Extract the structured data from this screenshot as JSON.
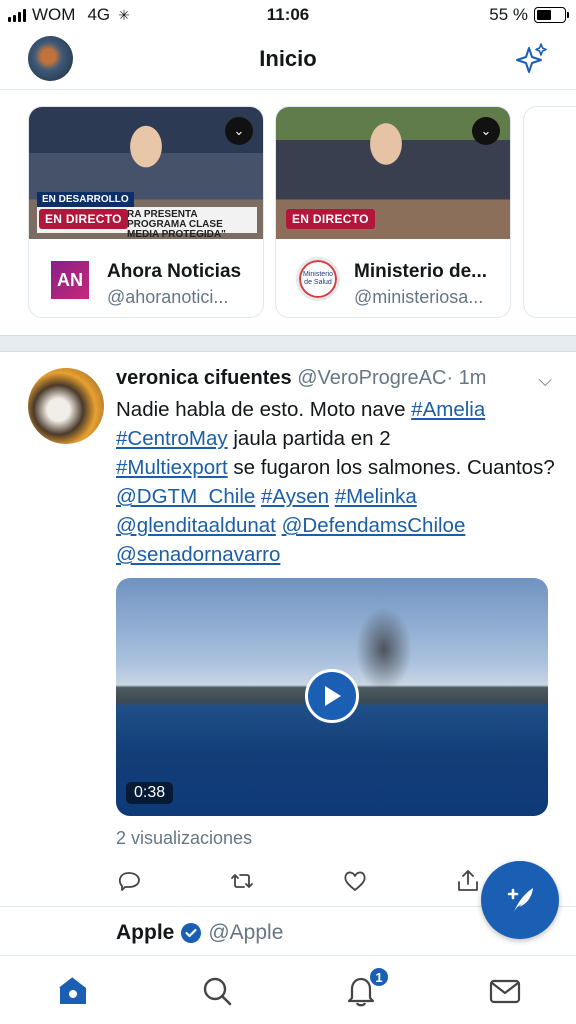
{
  "status_bar": {
    "carrier": "WOM",
    "network": "4G",
    "time": "11:06",
    "battery_label": "55 %",
    "battery_level": 0.55
  },
  "header": {
    "title": "Inicio",
    "left_icon": "profile-avatar",
    "right_icon": "sparkle-icon"
  },
  "live_cards": [
    {
      "name": "Ahora Noticias",
      "handle": "@ahoranotici...",
      "live_label": "EN DIRECTO",
      "lower_third_tag": "EN DESARROLLO",
      "lower_third_text": "RA PRESENTA PROGRAMA CLASE MEDIA PROTEGIDA\"",
      "logo_text": "AN"
    },
    {
      "name": "Ministerio de...",
      "handle": "@ministeriosa...",
      "live_label": "EN DIRECTO",
      "logo_text": "Ministerio de Salud"
    }
  ],
  "tweet": {
    "author_name": "veronica cifuentes",
    "author_handle": "@VeroProgreAC",
    "time": "· 1m",
    "text_plain_1": "Nadie habla de esto. Moto nave ",
    "tag_amelia": "#Amelia",
    "tag_centromay": "#CentroMay",
    "text_plain_2": " jaula partida en 2",
    "tag_multiexport": "#Multiexport",
    "text_plain_3": " se fugaron los salmones. Cuantos? ",
    "mention_dgtm": "@DGTM_Chile",
    "tag_aysen": "#Aysen",
    "tag_melinka": "#Melinka",
    "mention_glendita": "@glenditaaldunat",
    "mention_defendams": "@DefendamsChiloe",
    "mention_senador": "@senadornavarro",
    "video_duration": "0:38",
    "views": "2 visualizaciones"
  },
  "next_tweet": {
    "author_name": "Apple",
    "author_handle": "@Apple"
  },
  "tab_bar": {
    "notifications_badge": "1"
  },
  "colors": {
    "accent": "#1a5fb4",
    "live": "#b0173a",
    "secondary_text": "#657786"
  }
}
